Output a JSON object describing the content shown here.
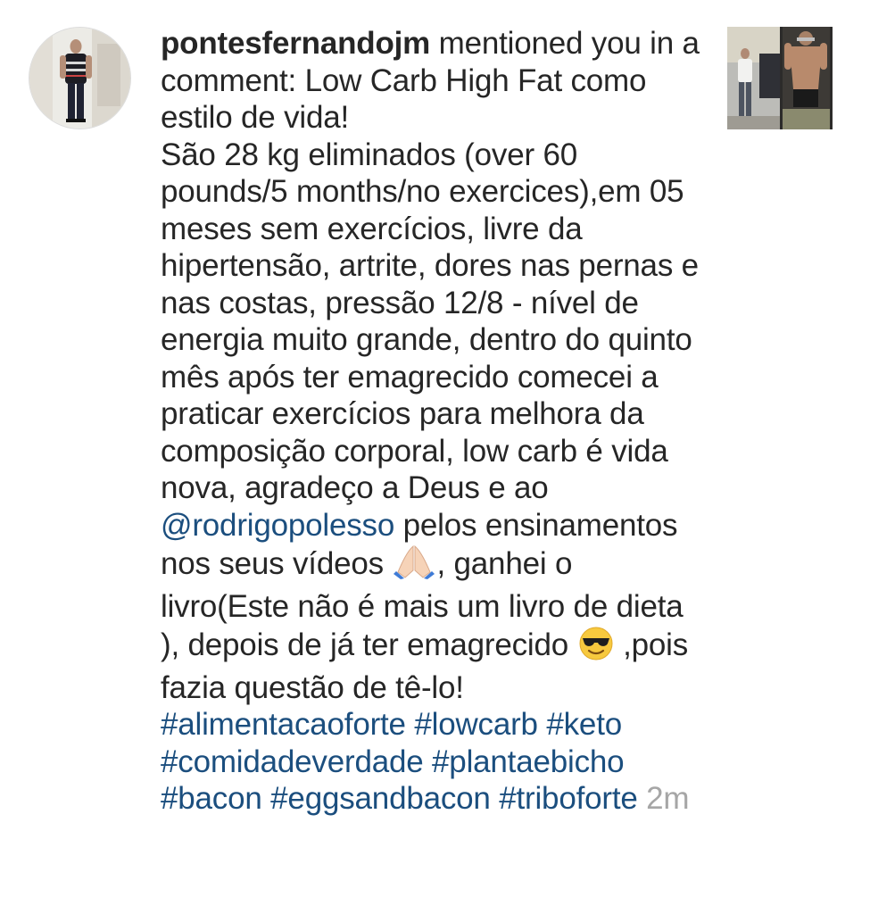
{
  "notification": {
    "username": "pontesfernandojm",
    "action_text": " mentioned you in a comment: Low Carb High Fat como estilo de vida!",
    "body_part1": "São 28 kg eliminados (over 60 pounds/5 months/no exercices),em 05 meses sem exercícios, livre da hipertensão, artrite, dores nas pernas e nas costas, pressão 12/8 - nível de energia muito grande, dentro do quinto mês após ter emagrecido comecei a praticar exercícios para melhora da composição corporal, low carb é vida nova, agradeço a Deus e ao ",
    "mention": "@rodrigopolesso",
    "body_part2": " pelos ensinamentos nos seus vídeos ",
    "emoji_1": "praying-hands-emoji",
    "body_part3": ", ganhei o livro(Este não é mais um livro de dieta ), depois de já ter emagrecido ",
    "emoji_2": "sunglasses-face-emoji",
    "body_part4": " ,pois fazia questão de tê-lo! ",
    "hashtags": [
      "#alimentacaoforte",
      "#lowcarb",
      "#keto",
      "#comidadeverdade",
      "#plantaebicho",
      "#bacon",
      "#eggsandbacon",
      "#triboforte"
    ],
    "time": "2m",
    "avatar": "user-avatar-photo",
    "thumbnail": "post-thumbnail-photo"
  },
  "colors": {
    "text": "#262626",
    "link": "#1b4e7e",
    "time": "#a6a6a6",
    "background": "#ffffff"
  }
}
